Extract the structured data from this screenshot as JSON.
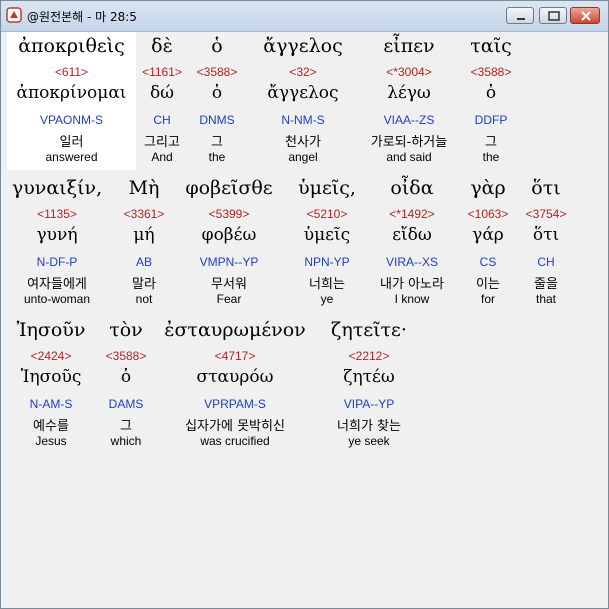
{
  "window": {
    "title": "@원전본해 - 마 28:5"
  },
  "lines": [
    {
      "words": [
        {
          "greek": "ἀποκριθεὶς",
          "strong": "<611>",
          "lemma": "ἀποκρίνομαι",
          "parse": "VPAONM-S",
          "korean": "일러",
          "english": "answered"
        },
        {
          "greek": "δὲ",
          "strong": "<1161>",
          "lemma": "δώ",
          "parse": "CH",
          "korean": "그리고",
          "english": "And"
        },
        {
          "greek": "ὁ",
          "strong": "<3588>",
          "lemma": "ὁ",
          "parse": "DNMS",
          "korean": "그",
          "english": "the"
        },
        {
          "greek": "ἄγγελος",
          "strong": "<32>",
          "lemma": "ἄγγελος",
          "parse": "N-NM-S",
          "korean": "천사가",
          "english": "angel"
        },
        {
          "greek": "εἶπεν",
          "strong": "<*3004>",
          "lemma": "λέγω",
          "parse": "VIAA--ZS",
          "korean": "가로되-하거늘",
          "english": "and said"
        },
        {
          "greek": "ταῖς",
          "strong": "<3588>",
          "lemma": "ὁ",
          "parse": "DDFP",
          "korean": "그",
          "english": "the"
        }
      ]
    },
    {
      "words": [
        {
          "greek": "γυναιξίν,",
          "strong": "<1135>",
          "lemma": "γυνή",
          "parse": "N-DF-P",
          "korean": "여자들에게",
          "english": "unto-woman"
        },
        {
          "greek": "Μὴ",
          "strong": "<3361>",
          "lemma": "μή",
          "parse": "AB",
          "korean": "말라",
          "english": "not"
        },
        {
          "greek": "φοβεῖσθε",
          "strong": "<5399>",
          "lemma": "φοβέω",
          "parse": "VMPN--YP",
          "korean": "무서워",
          "english": "Fear"
        },
        {
          "greek": "ὑμεῖς,",
          "strong": "<5210>",
          "lemma": "ὑμεῖς",
          "parse": "NPN-YP",
          "korean": "너희는",
          "english": "ye"
        },
        {
          "greek": "οἶδα",
          "strong": "<*1492>",
          "lemma": "εἴδω",
          "parse": "VIRA--XS",
          "korean": "내가 아노라",
          "english": "I know"
        },
        {
          "greek": "γὰρ",
          "strong": "<1063>",
          "lemma": "γάρ",
          "parse": "CS",
          "korean": "이는",
          "english": "for"
        },
        {
          "greek": "ὅτι",
          "strong": "<3754>",
          "lemma": "ὅτι",
          "parse": "CH",
          "korean": "줄을",
          "english": "that"
        }
      ]
    },
    {
      "words": [
        {
          "greek": "Ἰησοῦν",
          "strong": "<2424>",
          "lemma": "Ἰησοῦς",
          "parse": "N-AM-S",
          "korean": "예수를",
          "english": "Jesus"
        },
        {
          "greek": "τὸν",
          "strong": "<3588>",
          "lemma": "ὁ",
          "parse": "DAMS",
          "korean": "그",
          "english": "which"
        },
        {
          "greek": "ἐσταυρωμένον",
          "strong": "<4717>",
          "lemma": "σταυρόω",
          "parse": "VPRPAM-S",
          "korean": "십자가에 못박히신",
          "english": "was crucified"
        },
        {
          "greek": "ζητεῖτε·",
          "strong": "<2212>",
          "lemma": "ζητέω",
          "parse": "VIPA--YP",
          "korean": "너희가 찾는",
          "english": "ye seek"
        }
      ]
    }
  ]
}
